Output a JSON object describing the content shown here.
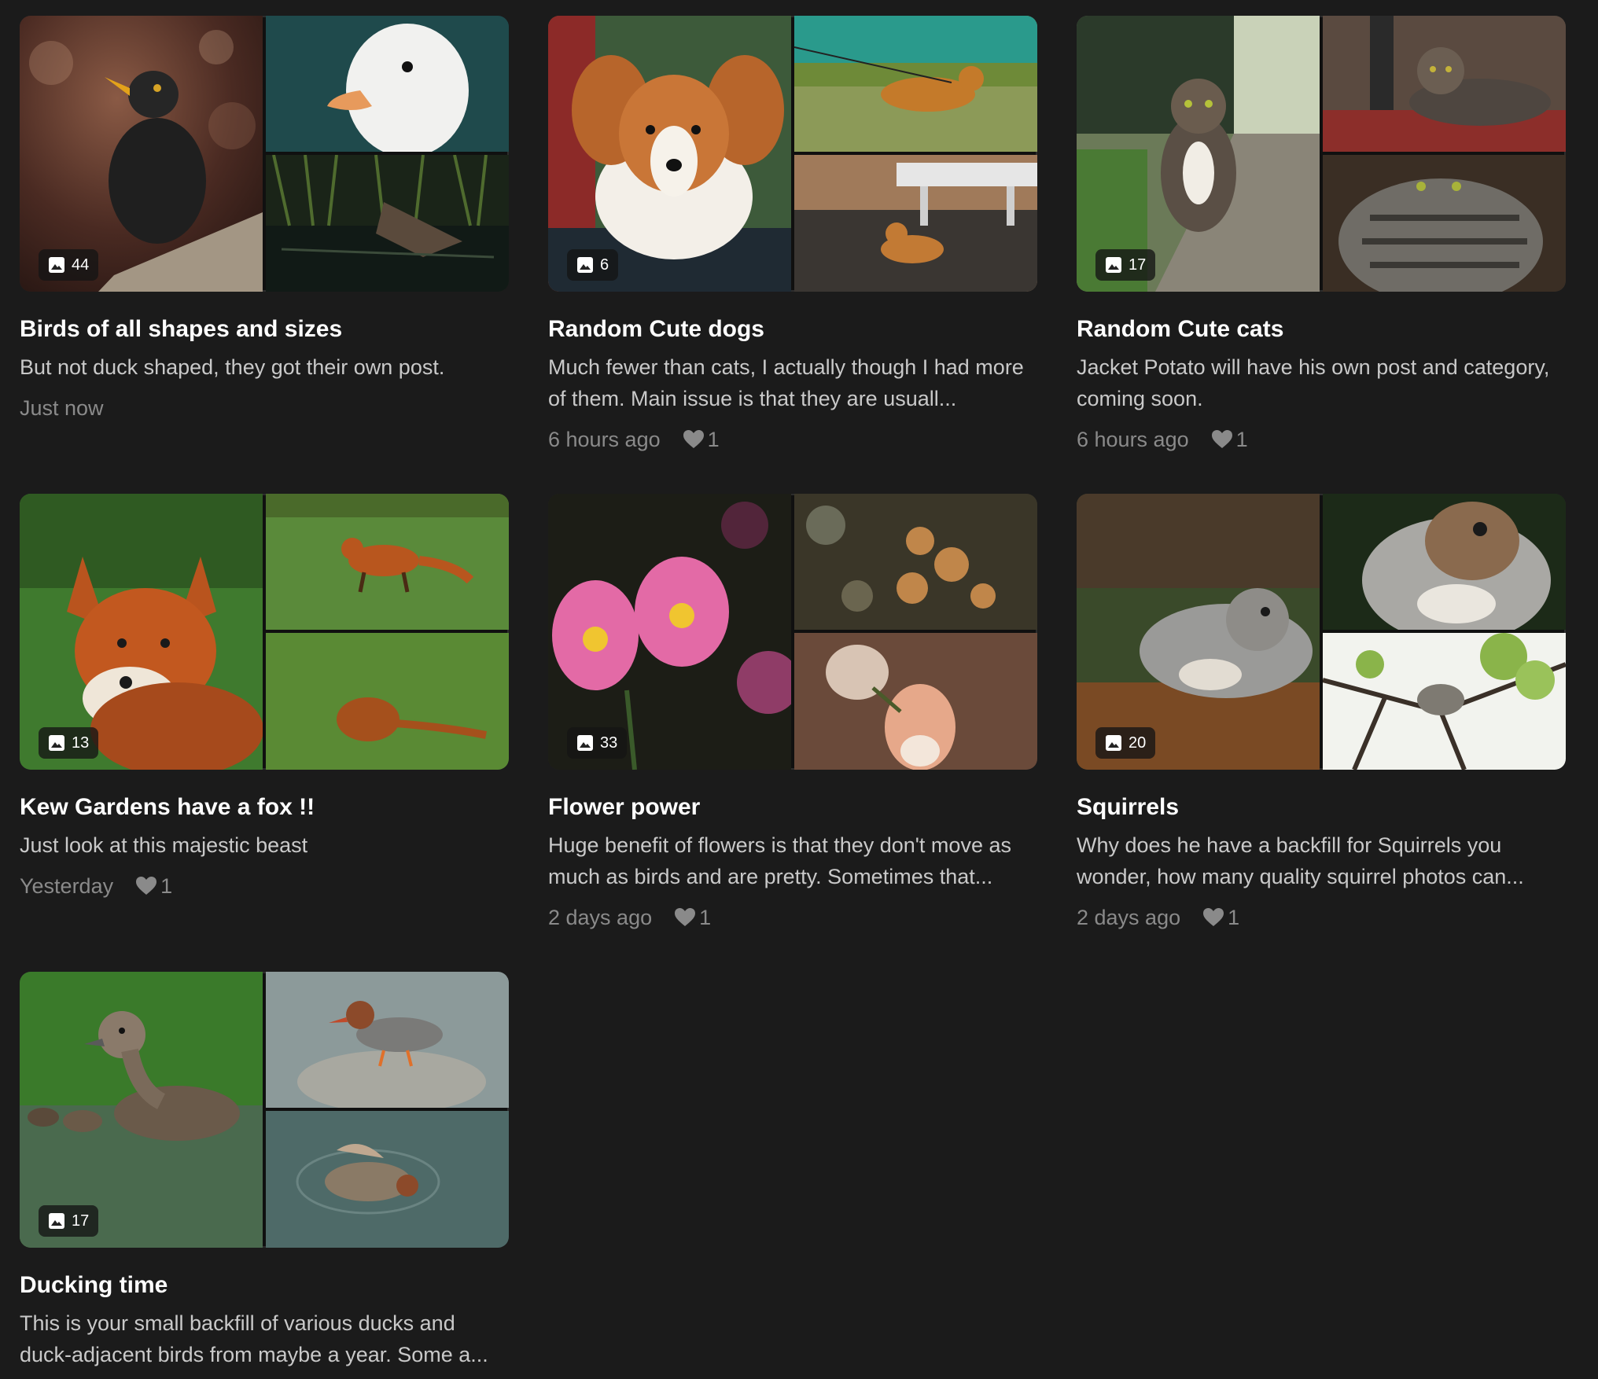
{
  "posts": [
    {
      "title": "Birds of all shapes and sizes",
      "description": "But not duck shaped, they got their own post.",
      "time": "Just now",
      "likes": "",
      "photo_count": "44",
      "photo_icon": "image-icon"
    },
    {
      "title": "Random Cute dogs",
      "description": "Much fewer than cats, I actually though I had more of them. Main issue is that they are usuall...",
      "time": "6 hours ago",
      "likes": "1",
      "photo_count": "6",
      "photo_icon": "image-icon"
    },
    {
      "title": "Random Cute cats",
      "description": "Jacket Potato will have his own post and category, coming soon.",
      "time": "6 hours ago",
      "likes": "1",
      "photo_count": "17",
      "photo_icon": "image-icon"
    },
    {
      "title": "Kew Gardens have a fox !!",
      "description": "Just look at this majestic beast",
      "time": "Yesterday",
      "likes": "1",
      "photo_count": "13",
      "photo_icon": "image-icon"
    },
    {
      "title": "Flower power",
      "description": "Huge benefit of flowers is that they don't move as much as birds and are pretty. Sometimes that...",
      "time": "2 days ago",
      "likes": "1",
      "photo_count": "33",
      "photo_icon": "image-icon"
    },
    {
      "title": "Squirrels",
      "description": "Why does he have a backfill for Squirrels you wonder, how many quality squirrel photos can...",
      "time": "2 days ago",
      "likes": "1",
      "photo_count": "20",
      "photo_icon": "image-icon"
    },
    {
      "title": "Ducking time",
      "description": "This is your small backfill of various ducks and duck-adjacent birds from maybe a year. Some a...",
      "time": "",
      "likes": "",
      "photo_count": "17",
      "photo_icon": "image-icon"
    }
  ],
  "colors": {
    "background": "#1b1b1b",
    "title": "#ffffff",
    "description": "#c9c9c9",
    "meta": "#8a8a8a"
  }
}
